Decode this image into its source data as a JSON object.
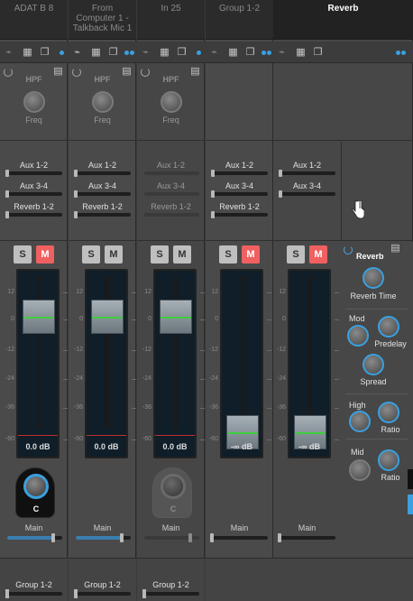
{
  "channels": [
    {
      "name_lines": [
        "ADAT B 8"
      ],
      "hpf_label": "HPF",
      "freq_label": "Freq",
      "aux": [
        "Aux 1-2",
        "Aux 3-4",
        "Reverb 1-2"
      ],
      "solo": "S",
      "mute": "M",
      "mute_active": true,
      "gain_db": "0.0 dB",
      "pan": "C",
      "main_label": "Main",
      "main_level": 0.82,
      "bottom_label": "Group 1-2"
    },
    {
      "name_lines": [
        "From",
        "Computer 1 -",
        "Talkback Mic 1"
      ],
      "hpf_label": "HPF",
      "freq_label": "Freq",
      "aux": [
        "Aux 1-2",
        "Aux 3-4",
        "Reverb 1-2"
      ],
      "solo": "S",
      "mute": "M",
      "mute_active": false,
      "gain_db": "0.0 dB",
      "pan": "",
      "main_label": "Main",
      "main_level": 0.82,
      "bottom_label": "Group 1-2"
    },
    {
      "name_lines": [
        "In 25"
      ],
      "hpf_label": "HPF",
      "freq_label": "Freq",
      "aux": [
        "Aux 1-2",
        "Aux 3-4",
        "Reverb 1-2"
      ],
      "solo": "S",
      "mute": "M",
      "mute_active": false,
      "gain_db": "0.0 dB",
      "pan": "C",
      "main_label": "Main",
      "main_level": 0.82,
      "bottom_label": "Group 1-2"
    },
    {
      "name_lines": [
        "Group 1-2"
      ],
      "aux": [
        "Aux 1-2",
        "Aux 3-4",
        "Reverb 1-2"
      ],
      "solo": "S",
      "mute": "M",
      "mute_active": true,
      "gain_db": "-∞ dB",
      "main_label": "Main",
      "main_level": 0.0
    },
    {
      "name_lines": [
        "Reverb"
      ],
      "aux": [
        "Aux 1-2",
        "Aux 3-4"
      ],
      "solo": "S",
      "mute": "M",
      "mute_active": true,
      "gain_db": "-∞ dB",
      "main_label": "Main",
      "main_level": 0.0
    }
  ],
  "scale_ticks": [
    "12",
    "0",
    "-12",
    "-24",
    "-36",
    "-60"
  ],
  "reverb_panel": {
    "title": "Reverb",
    "reverb_time": "Reverb Time",
    "mod": "Mod",
    "predelay": "Predelay",
    "spread": "Spread",
    "high": "High",
    "ratio_high": "Ratio",
    "mid": "Mid",
    "ratio_mid": "Ratio"
  },
  "colors": {
    "accent": "#3aa0e0",
    "mute_active": "#f06060",
    "meter_green": "#3fcf3f"
  }
}
